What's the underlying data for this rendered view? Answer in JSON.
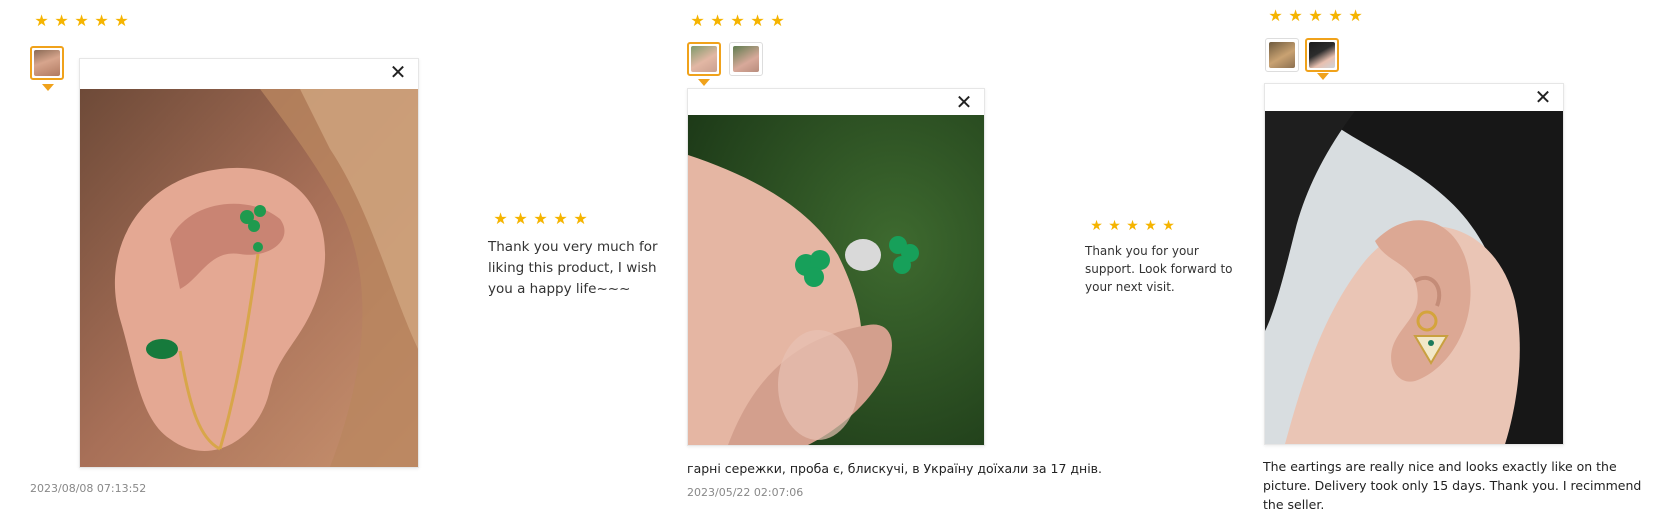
{
  "accent_color": "#f5b400",
  "selected_border_color": "#f0a21b",
  "star_glyph": "★",
  "close_glyph": "✕",
  "reviews": [
    {
      "rating": 5,
      "date": "2023/08/08 07:13:52",
      "text": "",
      "photo_count": 1,
      "selected_photo": 1,
      "reply": {
        "rating": 5,
        "text": "Thank you very much for liking this product, I wish you a happy life~~~"
      }
    },
    {
      "rating": 5,
      "date": "2023/05/22 02:07:06",
      "text": "гарні сережки, проба є, блискучі, в Україну доїхали за 17 днів.",
      "photo_count": 2,
      "selected_photo": 1,
      "reply": {
        "rating": 5,
        "text": "Thank you for your support. Look forward to your next visit."
      }
    },
    {
      "rating": 5,
      "date": "",
      "text": "The eartings are really nice and looks exactly like on the picture. Delivery took only 15 days. Thank you. I recimmend the seller.",
      "photo_count": 2,
      "selected_photo": 2,
      "reply": null
    }
  ]
}
